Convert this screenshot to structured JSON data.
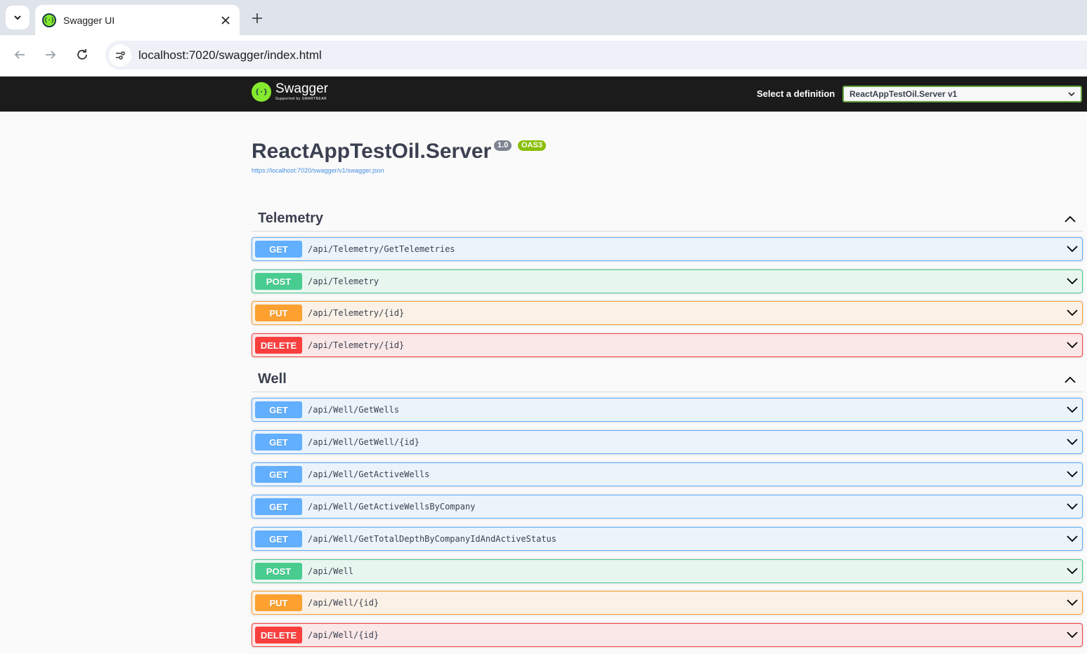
{
  "browser": {
    "tab_title": "Swagger UI",
    "url": "localhost:7020/swagger/index.html",
    "icons": [
      "tab-list-icon",
      "close-icon",
      "plus-icon",
      "back-arrow-icon",
      "forward-arrow-icon",
      "reload-icon",
      "site-info-icon"
    ]
  },
  "topbar": {
    "logo_text": "Swagger",
    "logo_sub": "Supported by SMARTBEAR",
    "definition_label": "Select a definition",
    "definition_value": "ReactAppTestOil.Server v1"
  },
  "info": {
    "title": "ReactAppTestOil.Server",
    "version": "1.0",
    "oas": "OAS3",
    "spec_url": "https://localhost:7020/swagger/v1/swagger.json"
  },
  "tags": [
    {
      "name": "Telemetry",
      "operations": [
        {
          "method": "GET",
          "path": "/api/Telemetry/GetTelemetries"
        },
        {
          "method": "POST",
          "path": "/api/Telemetry"
        },
        {
          "method": "PUT",
          "path": "/api/Telemetry/{id}"
        },
        {
          "method": "DELETE",
          "path": "/api/Telemetry/{id}"
        }
      ]
    },
    {
      "name": "Well",
      "operations": [
        {
          "method": "GET",
          "path": "/api/Well/GetWells"
        },
        {
          "method": "GET",
          "path": "/api/Well/GetWell/{id}"
        },
        {
          "method": "GET",
          "path": "/api/Well/GetActiveWells"
        },
        {
          "method": "GET",
          "path": "/api/Well/GetActiveWellsByCompany"
        },
        {
          "method": "GET",
          "path": "/api/Well/GetTotalDepthByCompanyIdAndActiveStatus"
        },
        {
          "method": "POST",
          "path": "/api/Well"
        },
        {
          "method": "PUT",
          "path": "/api/Well/{id}"
        },
        {
          "method": "DELETE",
          "path": "/api/Well/{id}"
        }
      ]
    }
  ],
  "colors": {
    "get": "#61affe",
    "post": "#49cc90",
    "put": "#fca130",
    "delete": "#f93e3e",
    "topbar": "#1b1b1b",
    "swagger_green": "#85ea2d"
  }
}
